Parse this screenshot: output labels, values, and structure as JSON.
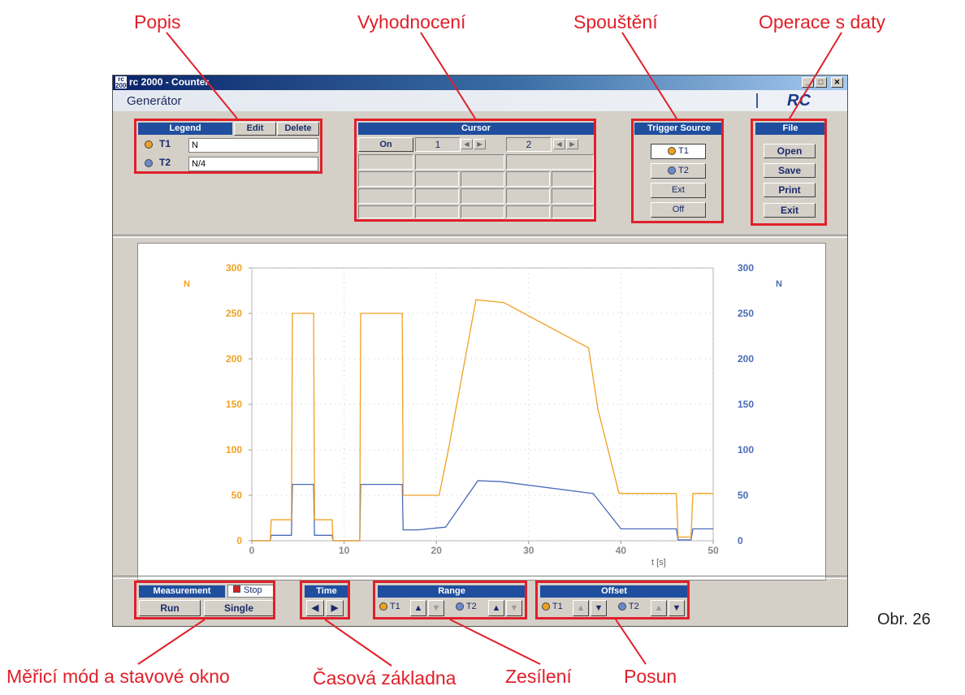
{
  "annotations": {
    "popis": "Popis",
    "vyhodnoceni": "Vyhodnocení",
    "spousteni": "Spouštění",
    "operace": "Operace s daty",
    "mode": "Měřicí mód a stavové okno",
    "time_base": "Časová základna",
    "gain": "Zesílení",
    "shift": "Posun",
    "figure": "Obr. 26"
  },
  "window": {
    "title": "rc 2000 - Counter",
    "icon_text": "rc 2000",
    "header_title": "Generátor",
    "logo": "RC"
  },
  "legend": {
    "title": "Legend",
    "edit": "Edit",
    "delete": "Delete",
    "rows": [
      {
        "name": "T1",
        "value": "N",
        "color": "#f0a020"
      },
      {
        "name": "T2",
        "value": "N/4",
        "color": "#6a8ad0"
      }
    ]
  },
  "cursor": {
    "title": "Cursor",
    "on": "On",
    "c1": "1",
    "c2": "2"
  },
  "trigger": {
    "title": "Trigger Source",
    "t1": "T1",
    "t2": "T2",
    "ext": "Ext",
    "off": "Off"
  },
  "file": {
    "title": "File",
    "open": "Open",
    "save": "Save",
    "print": "Print",
    "exit": "Exit"
  },
  "measurement": {
    "title": "Measurement",
    "status": "Stop",
    "run": "Run",
    "single": "Single"
  },
  "time": {
    "title": "Time"
  },
  "range": {
    "title": "Range",
    "t1": "T1",
    "t2": "T2"
  },
  "offset": {
    "title": "Offset",
    "t1": "T1",
    "t2": "T2"
  },
  "chart_data": {
    "type": "line",
    "xlabel": "t [s]",
    "ylabel_left": "N",
    "ylabel_right": "N",
    "xlim": [
      0,
      50
    ],
    "ylim": [
      0,
      300
    ],
    "x_ticks": [
      "0",
      "10",
      "20",
      "30",
      "40",
      "50"
    ],
    "y_ticks": [
      "0",
      "50",
      "100",
      "150",
      "200",
      "250",
      "300"
    ],
    "grid": "dotted",
    "colors": {
      "T1": "#f0a020",
      "T2": "#4a6ab8"
    },
    "series": [
      {
        "name": "T1",
        "x": [
          0,
          2,
          2.1,
          4.3,
          4.4,
          6.7,
          6.8,
          8.7,
          8.8,
          11.7,
          11.8,
          16.3,
          16.4,
          20.3,
          21.3,
          24.3,
          27.3,
          36.5,
          37.5,
          39.8,
          40,
          46,
          46.2,
          47.6,
          47.8,
          50
        ],
        "y": [
          0,
          0,
          23,
          23,
          250,
          250,
          23,
          23,
          0,
          0,
          250,
          250,
          50,
          50,
          100,
          265,
          262,
          212,
          145,
          52,
          52,
          52,
          4,
          4,
          52,
          52
        ]
      },
      {
        "name": "T2",
        "x": [
          0,
          2,
          2.1,
          4.3,
          4.4,
          6.7,
          6.8,
          8.7,
          8.8,
          11.7,
          11.8,
          16.3,
          16.4,
          18,
          21,
          24.5,
          27,
          37,
          40,
          46,
          46.2,
          47.6,
          47.8,
          50
        ],
        "y": [
          0,
          0,
          6,
          6,
          62,
          62,
          6,
          6,
          0,
          0,
          62,
          62,
          12,
          12,
          15,
          66,
          65,
          52,
          13,
          13,
          1,
          1,
          13,
          13
        ]
      }
    ]
  }
}
